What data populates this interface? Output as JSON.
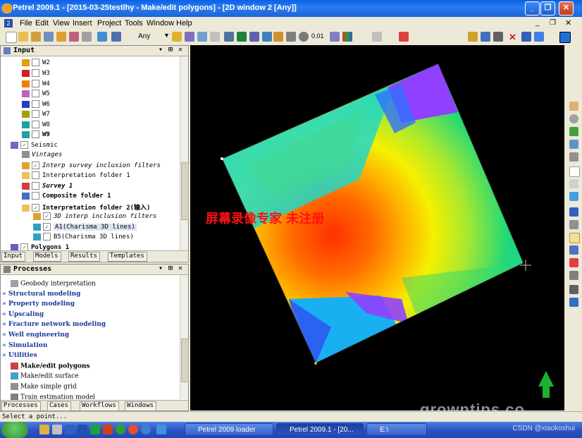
{
  "window": {
    "title": "Petrel 2009.1 - [2015-03-25testlhy - Make/edit polygons] - [2D window 2 [Any]]"
  },
  "menu": [
    "File",
    "Edit",
    "View",
    "Insert",
    "Project",
    "Tools",
    "Window",
    "Help"
  ],
  "toolbar": {
    "dropdown_value": "Any",
    "zoom_value": "0.01"
  },
  "input_panel": {
    "title": "Input",
    "items": [
      {
        "label": "W2",
        "checked": false
      },
      {
        "label": "W3",
        "checked": false
      },
      {
        "label": "W4",
        "checked": false
      },
      {
        "label": "W5",
        "checked": false
      },
      {
        "label": "W6",
        "checked": false
      },
      {
        "label": "W7",
        "checked": false
      },
      {
        "label": "W8",
        "checked": false
      },
      {
        "label": "W9",
        "checked": false
      },
      {
        "label": "Seismic",
        "checked": true
      },
      {
        "label": "Vintages",
        "checked": false
      },
      {
        "label": "Interp survey inclusion filters",
        "checked": true
      },
      {
        "label": "Interpretation folder 1",
        "checked": false
      },
      {
        "label": "Survey 1",
        "checked": false
      },
      {
        "label": "Composite folder 1",
        "checked": false
      },
      {
        "label": "Interpretation folder 2(输入)",
        "checked": true
      },
      {
        "label": "3D interp inclusion filters",
        "checked": true
      },
      {
        "label": "A1(Charisma 3D lines)",
        "checked": true
      },
      {
        "label": "B5(Charisma 3D lines)",
        "checked": false
      },
      {
        "label": "Polygons 1",
        "checked": true
      }
    ],
    "tabs": [
      "Input",
      "Models",
      "Results",
      "Templates"
    ]
  },
  "processes_panel": {
    "title": "Processes",
    "items": [
      "Geobody interpretation",
      "Structural modeling",
      "Property modeling",
      "Upscaling",
      "Fracture network modeling",
      "Well engineering",
      "Simulation",
      "Utilities",
      "Make/edit polygons",
      "Make/edit surface",
      "Make simple grid",
      "Train estimation model"
    ],
    "tabs": [
      "Processes",
      "Cases",
      "Workflows",
      "Windows"
    ]
  },
  "viewport": {
    "watermark": "屏幕录像专家 未注册",
    "site_watermark": "growntips.co"
  },
  "status": {
    "text": "Select a point..."
  },
  "taskbar": {
    "items": [
      "Petrel 2009 loader",
      "Petrel 2009.1 - [20...",
      "E:\\"
    ],
    "csdn": "CSDN @xiaokoshui"
  },
  "colors": {
    "accent": "#0a5fe6",
    "watermark": "#ff1010"
  }
}
